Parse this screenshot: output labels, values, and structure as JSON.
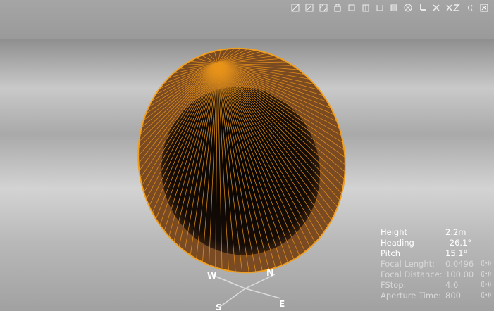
{
  "toolbar": {
    "icons": [
      "view-quad-icon",
      "view-wire-icon",
      "view-shaded-icon",
      "camera-icon",
      "frame-icon",
      "pan-icon",
      "orbit-icon",
      "grid-icon",
      "target-icon",
      "axis-y-icon",
      "axis-x-icon",
      "axis-xz-icon",
      "sound-icon",
      "close-icon"
    ]
  },
  "camera_info": {
    "rows": [
      {
        "label": "Height",
        "value": "2.2m",
        "active": true
      },
      {
        "label": "Heading",
        "value": "–26.1°",
        "active": true
      },
      {
        "label": "Pitch",
        "value": "15.1°",
        "active": true
      },
      {
        "label": "Focal Lenght:",
        "value": "0.0496",
        "active": false
      },
      {
        "label": "Focal Distance:",
        "value": "100.00",
        "active": false
      },
      {
        "label": "FStop:",
        "value": "4.0",
        "active": false
      },
      {
        "label": "Aperture Time:",
        "value": "800",
        "active": false
      }
    ],
    "dial_glyph": "((•))"
  },
  "compass": {
    "n": "N",
    "w": "W",
    "e": "E",
    "s": "S"
  },
  "colors": {
    "wire": "#e8941a",
    "fill": "#7a4a20",
    "inner": "#0b0705",
    "background": "#b5b5b5"
  }
}
